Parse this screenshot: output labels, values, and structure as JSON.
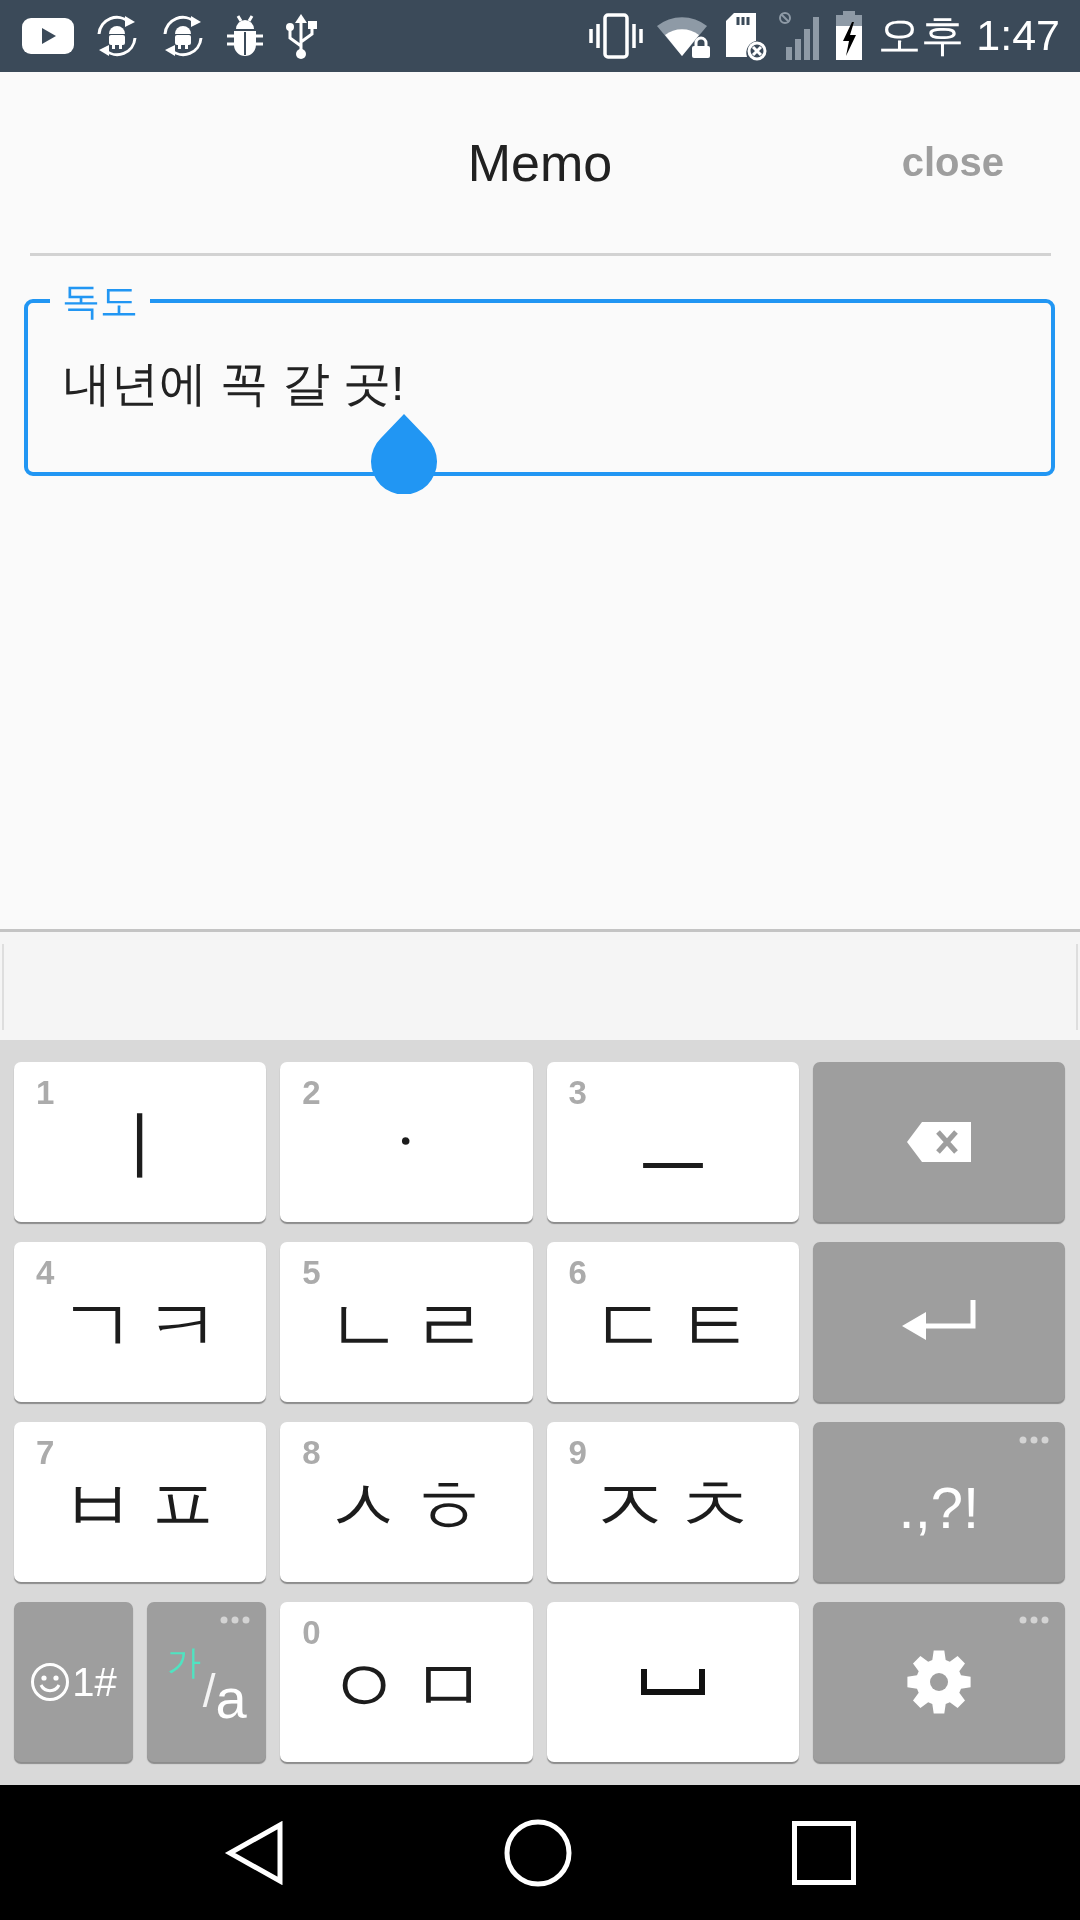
{
  "status_bar": {
    "time": "오후 1:47"
  },
  "header": {
    "title": "Memo",
    "close_button": "close"
  },
  "memo_field": {
    "label": "독도",
    "value": "내년에 꼭 갈 곳!",
    "focused": true
  },
  "keyboard": {
    "rows": [
      [
        {
          "kind": "letter",
          "hint": "1",
          "label": "ㅣ",
          "more_options": false
        },
        {
          "kind": "letter",
          "hint": "2",
          "label": "ㆍ",
          "more_options": false
        },
        {
          "kind": "letter",
          "hint": "3",
          "label": "ㅡ",
          "more_options": false
        },
        {
          "kind": "backspace",
          "more_options": false
        }
      ],
      [
        {
          "kind": "letter",
          "hint": "4",
          "label": "ㄱ ㅋ",
          "more_options": false
        },
        {
          "kind": "letter",
          "hint": "5",
          "label": "ㄴ ㄹ",
          "more_options": false
        },
        {
          "kind": "letter",
          "hint": "6",
          "label": "ㄷ ㅌ",
          "more_options": false
        },
        {
          "kind": "enter",
          "more_options": false
        }
      ],
      [
        {
          "kind": "letter",
          "hint": "7",
          "label": "ㅂ ㅍ",
          "more_options": false
        },
        {
          "kind": "letter",
          "hint": "8",
          "label": "ㅅ ㅎ",
          "more_options": false
        },
        {
          "kind": "letter",
          "hint": "9",
          "label": "ㅈ ㅊ",
          "more_options": false
        },
        {
          "kind": "symbols",
          "label": ".,?!",
          "more_options": true
        }
      ],
      [
        {
          "kind": "pair",
          "keys": [
            {
              "kind": "emoji",
              "label": "1#",
              "more_options": false
            },
            {
              "kind": "language",
              "primary": "가",
              "separator": "/",
              "secondary": "a",
              "more_options": true
            }
          ]
        },
        {
          "kind": "letter",
          "hint": "0",
          "label": "ㅇ ㅁ",
          "more_options": false
        },
        {
          "kind": "space",
          "more_options": false
        },
        {
          "kind": "settings",
          "more_options": true
        }
      ]
    ]
  }
}
